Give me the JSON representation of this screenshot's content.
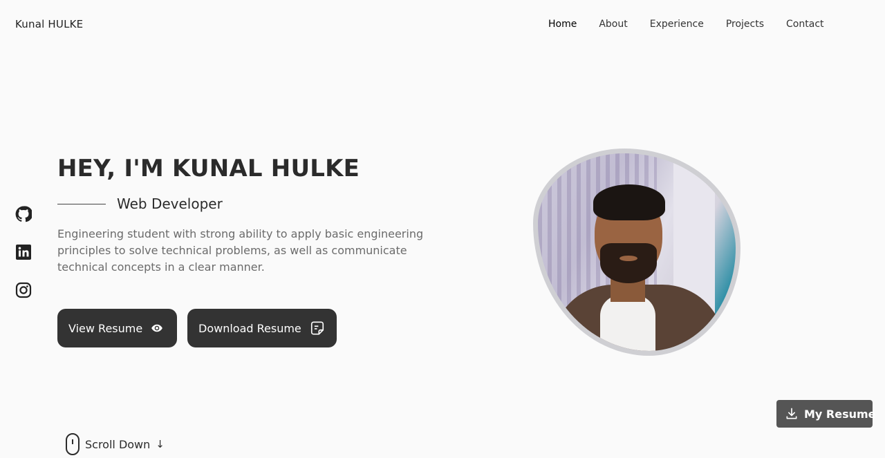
{
  "header": {
    "logo": "Kunal HULKE",
    "nav": [
      {
        "label": "Home",
        "active": true
      },
      {
        "label": "About",
        "active": false
      },
      {
        "label": "Experience",
        "active": false
      },
      {
        "label": "Projects",
        "active": false
      },
      {
        "label": "Contact",
        "active": false
      }
    ]
  },
  "social": [
    {
      "icon": "github-icon"
    },
    {
      "icon": "linkedin-icon"
    },
    {
      "icon": "instagram-icon"
    }
  ],
  "hero": {
    "title": "HEY, I'M KUNAL HULKE",
    "subtitle": "Web Developer",
    "description": "Engineering student with strong ability to apply basic engineering principles to solve technical problems, as well as communicate technical concepts in a clear manner.",
    "buttons": {
      "view_resume": "View Resume",
      "download_resume": "Download Resume"
    }
  },
  "fab": {
    "label": "My Resume"
  },
  "scroll": {
    "label": "Scroll Down",
    "arrow": "↓"
  },
  "colors": {
    "button_bg": "#333333",
    "fab_bg": "#555555",
    "background": "#fafafa"
  }
}
